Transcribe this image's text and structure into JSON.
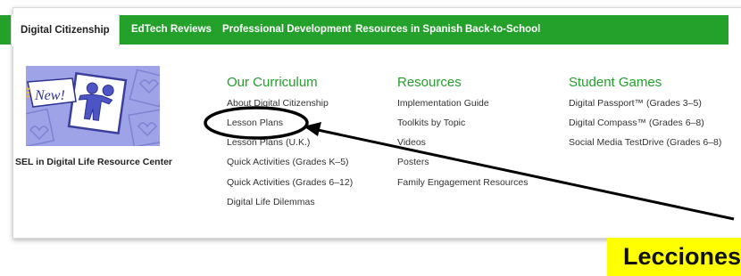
{
  "nav": {
    "tabs": [
      {
        "label": "Digital Citizenship"
      },
      {
        "label": "EdTech Reviews"
      },
      {
        "label": "Professional Development"
      },
      {
        "label": "Resources in Spanish"
      },
      {
        "label": "Back-to-School"
      }
    ]
  },
  "promo": {
    "badge": "New!",
    "caption": "SEL in Digital Life Resource Center"
  },
  "columns": [
    {
      "title": "Our Curriculum",
      "links": [
        "About Digital Citizenship",
        "Lesson Plans",
        "Lesson Plans (U.K.)",
        "Quick Activities (Grades K–5)",
        "Quick Activities (Grades 6–12)",
        "Digital Life Dilemmas"
      ]
    },
    {
      "title": "Resources",
      "links": [
        "Implementation Guide",
        "Toolkits by Topic",
        "Videos",
        "Posters",
        "Family Engagement Resources"
      ]
    },
    {
      "title": "Student Games",
      "links": [
        "Digital Passport™ (Grades 3–5)",
        "Digital Compass™ (Grades 6–8)",
        "Social Media TestDrive (Grades 6–8)"
      ]
    }
  ],
  "annotation": {
    "callout_text": "Lecciones",
    "highlighted_item": "Lesson Plans"
  },
  "colors": {
    "nav_green": "#23a12b",
    "title_green": "#23a12b",
    "callout_yellow": "#ffff00",
    "promo_bg": "#9ea3e8"
  }
}
